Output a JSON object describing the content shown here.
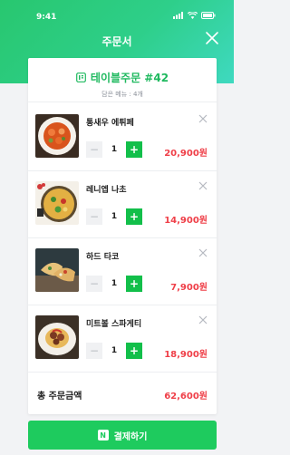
{
  "status": {
    "time": "9:41"
  },
  "header": {
    "title": "주문서"
  },
  "order": {
    "title": "테이블주문 #42",
    "subtitle": "담은 메뉴 : 4개"
  },
  "items": [
    {
      "name": "통새우 에튀페",
      "qty": "1",
      "price": "20,900원"
    },
    {
      "name": "레니엡 나초",
      "qty": "1",
      "price": "14,900원"
    },
    {
      "name": "하드 타코",
      "qty": "1",
      "price": "7,900원"
    },
    {
      "name": "미트볼 스파게티",
      "qty": "1",
      "price": "18,900원"
    }
  ],
  "total": {
    "label": "총 주문금액",
    "value": "62,600원"
  },
  "pay": {
    "label": "결제하기",
    "icon_text": "N"
  },
  "colors": {
    "brand": "#1ecb5e",
    "price": "#ef3f48"
  }
}
